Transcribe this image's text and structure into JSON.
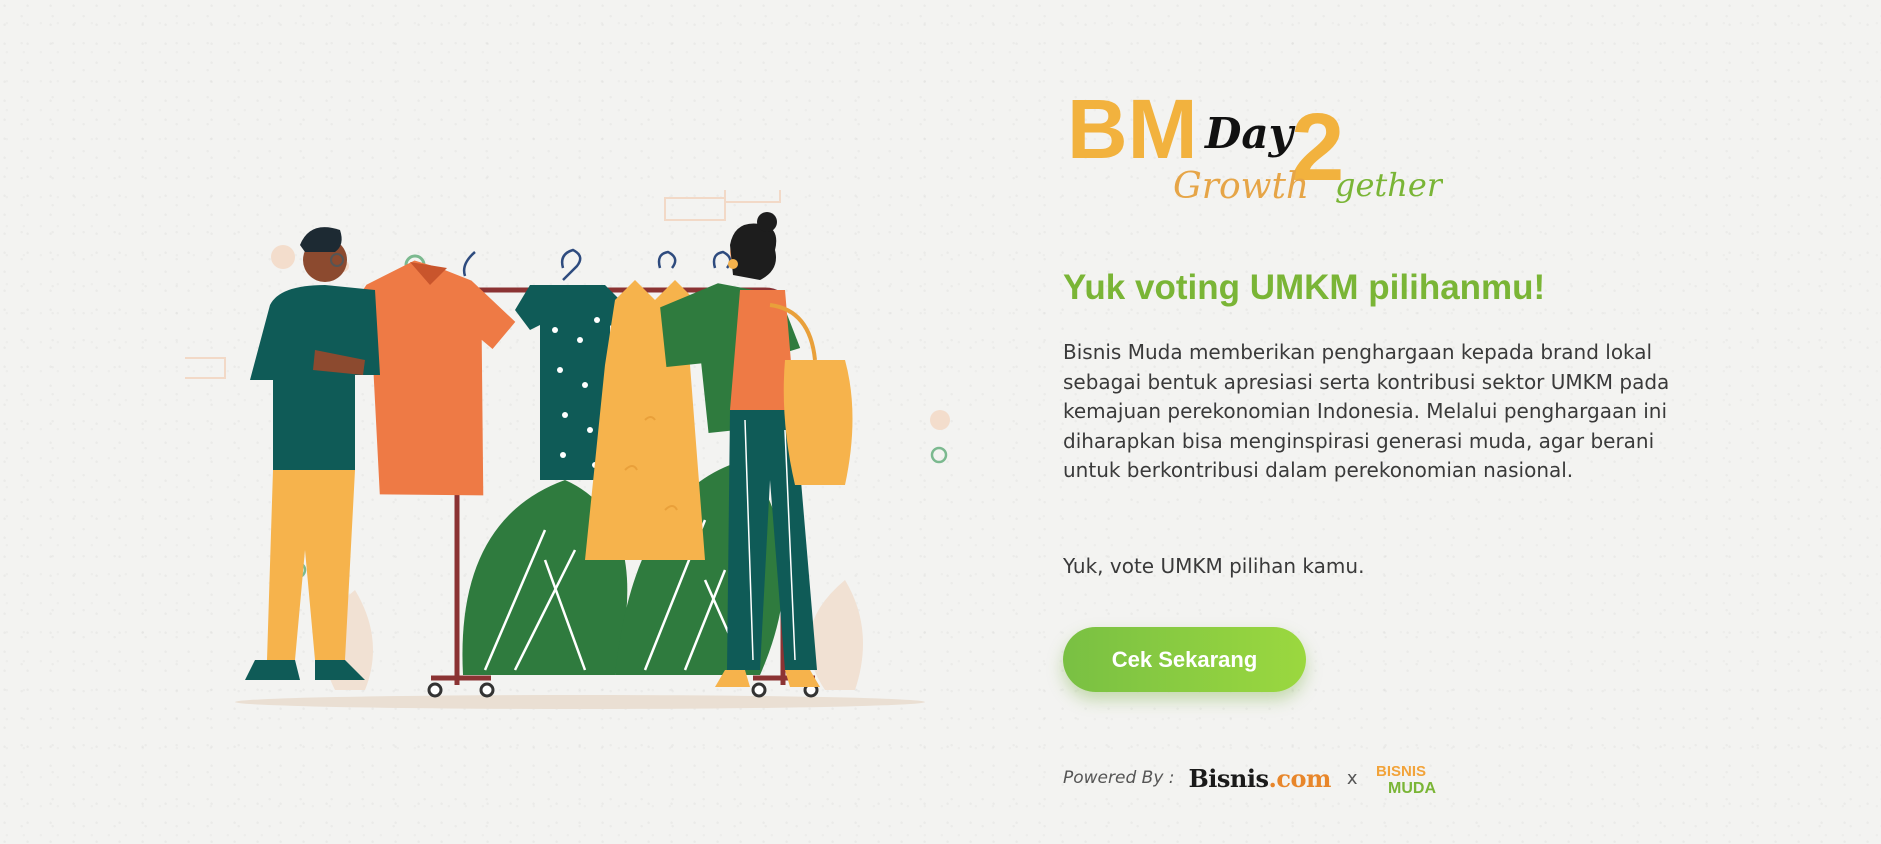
{
  "logo": {
    "letters": "BM",
    "day_text": "Day",
    "number": "2",
    "growth_text": "Growth",
    "gether_text": "gether"
  },
  "headline": "Yuk voting UMKM pilihanmu!",
  "description": "Bisnis Muda memberikan penghargaan kepada brand lokal sebagai bentuk apresiasi serta kontribusi sektor UMKM pada kemajuan perekonomian Indonesia. Melalui penghargaan ini diharapkan bisa menginspirasi generasi muda, agar berani untuk berkontribusi dalam perekonomian nasional.",
  "cta_text": "Yuk, vote UMKM pilihan kamu.",
  "cta_button": "Cek Sekarang",
  "powered": {
    "label": "Powered By :",
    "brand1_name": "Bisnis",
    "brand1_suffix": ".com",
    "separator": "x",
    "brand2_line1": "BISNIS",
    "brand2_line2": "MUDA"
  },
  "colors": {
    "accent_green": "#7ab536",
    "button_gradient": [
      "#79c043",
      "#9bd83f"
    ],
    "logo_orange": "#f2b23e",
    "logo_green": "#7ab536",
    "dark_teal": "#0f5b57",
    "shirt_orange": "#ee7a45",
    "leaf_green": "#2f7b3e"
  },
  "icons": [
    "clothes-rack-illustration",
    "bm-day-logo",
    "bisnis-com-logo",
    "bisnis-muda-logo"
  ]
}
